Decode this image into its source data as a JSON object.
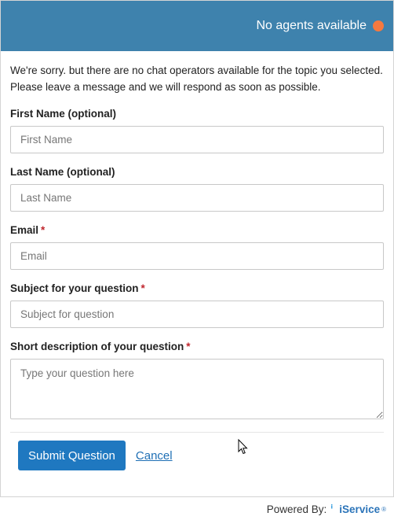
{
  "header": {
    "status_text": "No agents available",
    "status_color": "#f5793f",
    "bar_color": "#3e82ad"
  },
  "intro": {
    "line1": "We're sorry. but there are no chat operators available for the topic you selected.",
    "line2": "Please leave a message and we will respond as soon as possible."
  },
  "form": {
    "first_name": {
      "label": "First Name (optional)",
      "placeholder": "First Name",
      "value": ""
    },
    "last_name": {
      "label": "Last Name (optional)",
      "placeholder": "Last Name",
      "value": ""
    },
    "email": {
      "label": "Email",
      "required_mark": "*",
      "placeholder": "Email",
      "value": ""
    },
    "subject": {
      "label": "Subject for your question",
      "required_mark": "*",
      "placeholder": "Subject for question",
      "value": ""
    },
    "description": {
      "label": "Short description of your question",
      "required_mark": "*",
      "placeholder": "Type your question here",
      "value": ""
    }
  },
  "actions": {
    "submit_label": "Submit Question",
    "cancel_label": "Cancel"
  },
  "footer": {
    "powered_by": "Powered By:",
    "brand": "iService",
    "brand_reg": "®"
  }
}
